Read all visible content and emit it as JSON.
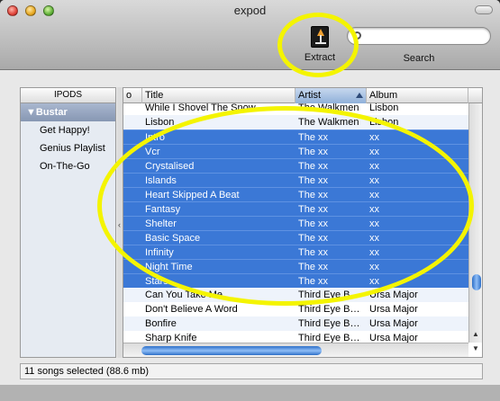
{
  "window": {
    "title": "expod"
  },
  "toolbar": {
    "extract_label": "Extract",
    "search_label": "Search",
    "search_value": "",
    "search_placeholder": ""
  },
  "sidebar": {
    "header": "IPODS",
    "group": "Bustar",
    "items": [
      {
        "label": "Get Happy!"
      },
      {
        "label": "Genius Playlist"
      },
      {
        "label": "On-The-Go"
      }
    ]
  },
  "table": {
    "columns": [
      "o",
      "Title",
      "Artist",
      "Album"
    ],
    "sorted_column": "Artist",
    "rows": [
      {
        "title": "While I Shovel The Snow",
        "artist": "The Walkmen",
        "album": "Lisbon",
        "selected": false
      },
      {
        "title": "Lisbon",
        "artist": "The Walkmen",
        "album": "Lisbon",
        "selected": false
      },
      {
        "title": "Intro",
        "artist": "The xx",
        "album": "xx",
        "selected": true
      },
      {
        "title": "Vcr",
        "artist": "The xx",
        "album": "xx",
        "selected": true
      },
      {
        "title": "Crystalised",
        "artist": "The xx",
        "album": "xx",
        "selected": true
      },
      {
        "title": "Islands",
        "artist": "The xx",
        "album": "xx",
        "selected": true
      },
      {
        "title": "Heart Skipped A Beat",
        "artist": "The xx",
        "album": "xx",
        "selected": true
      },
      {
        "title": "Fantasy",
        "artist": "The xx",
        "album": "xx",
        "selected": true
      },
      {
        "title": "Shelter",
        "artist": "The xx",
        "album": "xx",
        "selected": true
      },
      {
        "title": "Basic Space",
        "artist": "The xx",
        "album": "xx",
        "selected": true
      },
      {
        "title": "Infinity",
        "artist": "The xx",
        "album": "xx",
        "selected": true
      },
      {
        "title": "Night Time",
        "artist": "The xx",
        "album": "xx",
        "selected": true
      },
      {
        "title": "Stars",
        "artist": "The xx",
        "album": "xx",
        "selected": true
      },
      {
        "title": "Can You Take Me",
        "artist": "Third Eye B…",
        "album": "Ursa Major",
        "selected": false
      },
      {
        "title": "Don't Believe A Word",
        "artist": "Third Eye B…",
        "album": "Ursa Major",
        "selected": false
      },
      {
        "title": "Bonfire",
        "artist": "Third Eye B…",
        "album": "Ursa Major",
        "selected": false
      },
      {
        "title": "Sharp Knife",
        "artist": "Third Eye B…",
        "album": "Ursa Major",
        "selected": false
      }
    ]
  },
  "status": {
    "text": "11 songs selected (88.6 mb)"
  },
  "colors": {
    "selection": "#3b78d6",
    "annotation": "#f4f400",
    "sidebar_group": "#8797b3"
  }
}
